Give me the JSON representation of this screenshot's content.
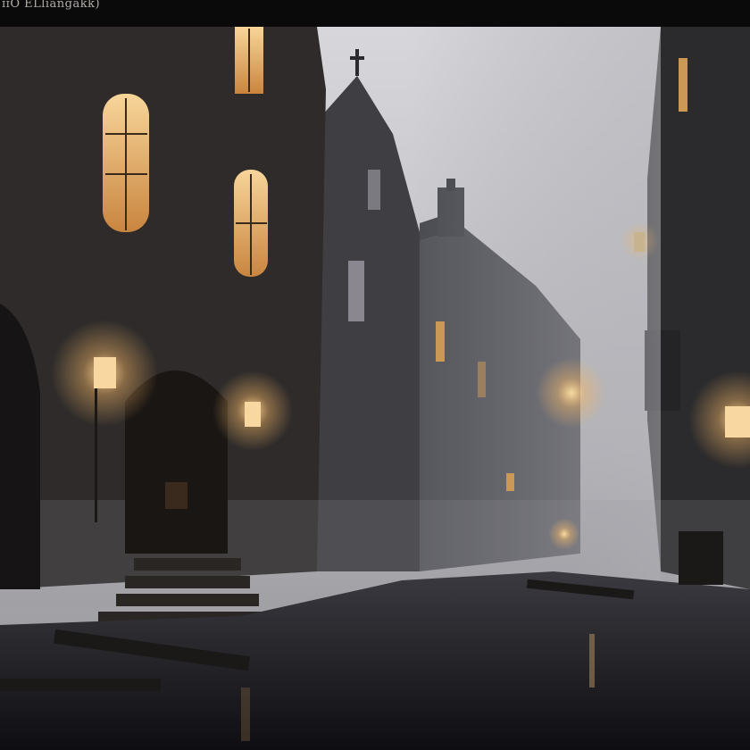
{
  "image": {
    "caption": "ɪɪȮ ELliangakk)"
  }
}
